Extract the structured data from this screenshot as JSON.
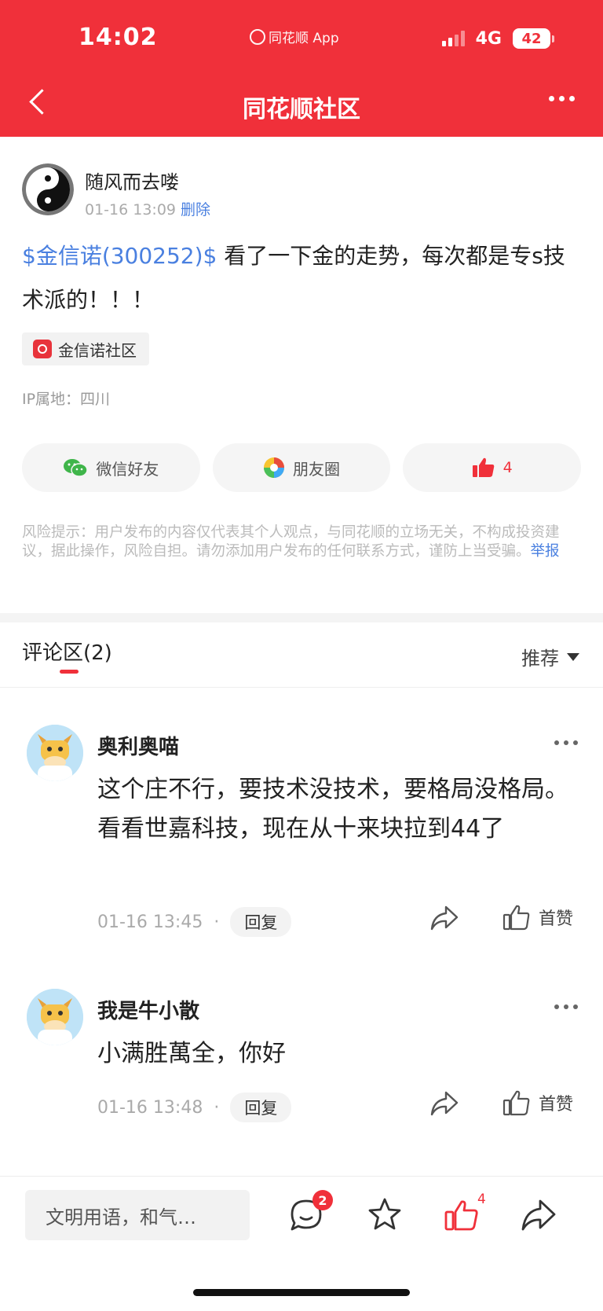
{
  "status_bar": {
    "time": "14:02",
    "app": "同花顺 App",
    "network": "4G",
    "battery": "42"
  },
  "nav": {
    "title": "同花顺社区"
  },
  "post": {
    "author": "随风而去喽",
    "time": "01-16 13:09",
    "delete_label": "删除",
    "stock_tag": "$金信诺(300252)$",
    "text": " 看了一下金的走势，每次都是专s技术派的！！！",
    "community": "金信诺社区",
    "ip": "IP属地：四川",
    "share_wechat": "微信好友",
    "share_moments": "朋友圈",
    "like_count": "4",
    "risk_text": "风险提示：用户发布的内容仅代表其个人观点，与同花顺的立场无关，不构成投资建议，据此操作，风险自担。请勿添加用户发布的任何联系方式，谨防上当受骗。",
    "report_label": "举报"
  },
  "comments_section": {
    "title": "评论区(2)",
    "sort_label": "推荐"
  },
  "comments": [
    {
      "name": "奥利奥喵",
      "text": "这个庄不行，要技术没技术，要格局没格局。看看世嘉科技，现在从十来块拉到44了",
      "time": "01-16 13:45",
      "reply_label": "回复",
      "like_label": "首赞"
    },
    {
      "name": "我是牛小散",
      "text": "小满胜萬全，你好",
      "time": "01-16 13:48",
      "reply_label": "回复",
      "like_label": "首赞"
    }
  ],
  "bottom_bar": {
    "input_placeholder": "文明用语，和气…",
    "comment_count": "2",
    "like_count": "4"
  },
  "colors": {
    "brand_red": "#f0303a",
    "link_blue": "#4a80e0"
  }
}
